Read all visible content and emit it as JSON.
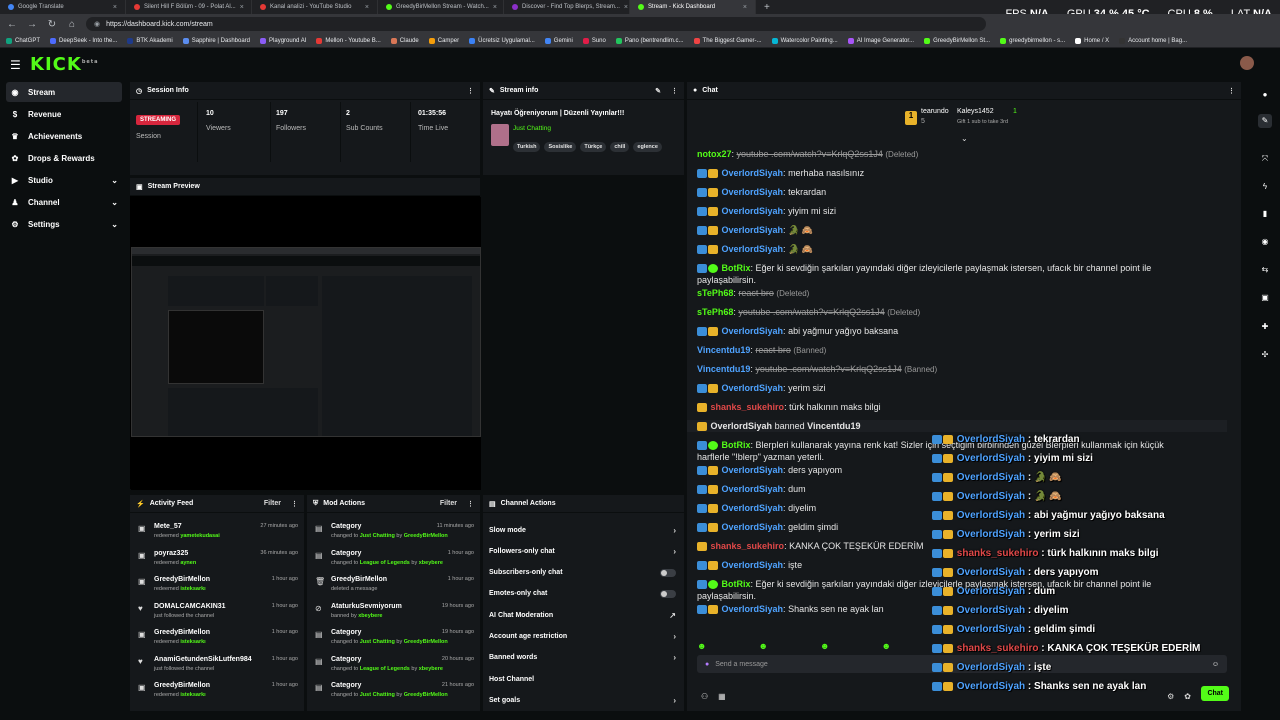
{
  "browser": {
    "tabs": [
      {
        "title": "Google Translate",
        "color": "#4285f4",
        "active": false
      },
      {
        "title": "Silent Hill F Bölüm - 09 - Polat Al...",
        "color": "#e53935",
        "active": false
      },
      {
        "title": "Kanal analizi - YouTube Studio",
        "color": "#e53935",
        "active": false
      },
      {
        "title": "GreedyBirMellon Stream - Watch...",
        "color": "#53fc18",
        "active": false
      },
      {
        "title": "Discover - Find Top Blerps, Stream...",
        "color": "#8b2fc9",
        "active": false
      },
      {
        "title": "Stream - Kick Dashboard",
        "color": "#53fc18",
        "active": true
      }
    ],
    "new_tab": "+",
    "url": "https://dashboard.kick.com/stream",
    "bookmarks": [
      "ChatGPT",
      "DeepSeek - Into the...",
      "BTK Akademi",
      "Sapphire | Dashboard",
      "Playground AI",
      "Mellon - Youtube B...",
      "Claude",
      "Camper",
      "Ücretsiz Uygulamal...",
      "Gemini",
      "Suno",
      "Pano (bentrendlim.c...",
      "The Biggest Gamer-...",
      "Watercolor Painting...",
      "AI Image Generator...",
      "GreedyBirMellon St...",
      "greedybirmellon - s...",
      "Home / X",
      "Account home | Bag..."
    ]
  },
  "sysstats": {
    "fps_label": "FPS",
    "fps_value": "N/A",
    "gpu_label": "GPU",
    "gpu_value": "34 % 45 °C",
    "cpu_label": "CPU",
    "cpu_value": "8 %",
    "lat_label": "LAT",
    "lat_value": "N/A"
  },
  "app": {
    "logo": "KICK",
    "logo_sup": "beta"
  },
  "sidebar": {
    "items": [
      {
        "label": "Stream",
        "icon": "broadcast-icon",
        "active": true,
        "expandable": false
      },
      {
        "label": "Revenue",
        "icon": "dollar-icon",
        "active": false,
        "expandable": false
      },
      {
        "label": "Achievements",
        "icon": "trophy-icon",
        "active": false,
        "expandable": false
      },
      {
        "label": "Drops & Rewards",
        "icon": "gift-icon",
        "active": false,
        "expandable": false
      },
      {
        "label": "Studio",
        "icon": "video-icon",
        "active": false,
        "expandable": true
      },
      {
        "label": "Channel",
        "icon": "user-icon",
        "active": false,
        "expandable": true
      },
      {
        "label": "Settings",
        "icon": "gear-icon",
        "active": false,
        "expandable": true
      }
    ]
  },
  "session": {
    "title": "Session Info",
    "status_badge": "STREAMING",
    "status_label": "Session",
    "stats": [
      {
        "value": "10",
        "label": "Viewers"
      },
      {
        "value": "197",
        "label": "Followers"
      },
      {
        "value": "2",
        "label": "Sub Counts"
      },
      {
        "value": "01:35:56",
        "label": "Time Live"
      }
    ]
  },
  "stream_info": {
    "title": "Stream info",
    "stream_title": "Hayatı Öğreniyorum | Düzenli Yayınlar!!!",
    "category": "Just Chatting",
    "tags": [
      "Turkish",
      "Sosislike",
      "Türkçe",
      "chill",
      "eglence"
    ]
  },
  "preview": {
    "title": "Stream Preview"
  },
  "activity": {
    "title": "Activity Feed",
    "filter": "Filter",
    "items": [
      {
        "name": "Mete_57",
        "action": "redeemed",
        "detail": "yametekudasai",
        "time": "27 minutes ago",
        "icon": "reward-icon"
      },
      {
        "name": "poyraz325",
        "action": "redeemed",
        "detail": "aynen",
        "time": "36 minutes ago",
        "icon": "reward-icon"
      },
      {
        "name": "GreedyBirMellon",
        "action": "redeemed",
        "detail": "isteksarkı",
        "time": "1 hour ago",
        "icon": "reward-icon"
      },
      {
        "name": "DOMALCAMCAKIN31",
        "action": "just followed the channel",
        "detail": "",
        "time": "1 hour ago",
        "icon": "heart-icon"
      },
      {
        "name": "GreedyBirMellon",
        "action": "redeemed",
        "detail": "isteksarkı",
        "time": "1 hour ago",
        "icon": "reward-icon"
      },
      {
        "name": "AnamiGetundenSikLutfen984",
        "action": "just followed the channel",
        "detail": "",
        "time": "1 hour ago",
        "icon": "heart-icon"
      },
      {
        "name": "GreedyBirMellon",
        "action": "redeemed",
        "detail": "isteksarkı",
        "time": "1 hour ago",
        "icon": "reward-icon"
      }
    ]
  },
  "mod_actions": {
    "title": "Mod Actions",
    "filter": "Filter",
    "items": [
      {
        "name": "Category",
        "line": "changed to",
        "target": "Just Chatting",
        "by": "by",
        "actor": "GreedyBirMellon",
        "time": "11 minutes ago",
        "icon": "category-icon"
      },
      {
        "name": "Category",
        "line": "changed to",
        "target": "League of Legends",
        "by": "by",
        "actor": "xbeybere",
        "time": "1 hour ago",
        "icon": "category-icon"
      },
      {
        "name": "GreedyBirMellon",
        "line": "deleted a message",
        "target": "",
        "by": "",
        "actor": "",
        "time": "1 hour ago",
        "icon": "trash-icon"
      },
      {
        "name": "AtaturkuSevmiyorum",
        "line": "banned by",
        "target": "",
        "by": "",
        "actor": "xbeybere",
        "time": "19 hours ago",
        "icon": "ban-icon"
      },
      {
        "name": "Category",
        "line": "changed to",
        "target": "Just Chatting",
        "by": "by",
        "actor": "GreedyBirMellon",
        "time": "19 hours ago",
        "icon": "category-icon"
      },
      {
        "name": "Category",
        "line": "changed to",
        "target": "League of Legends",
        "by": "by",
        "actor": "xbeybere",
        "time": "20 hours ago",
        "icon": "category-icon"
      },
      {
        "name": "Category",
        "line": "changed to",
        "target": "Just Chatting",
        "by": "by",
        "actor": "GreedyBirMellon",
        "time": "21 hours ago",
        "icon": "category-icon"
      }
    ]
  },
  "channel_actions": {
    "title": "Channel Actions",
    "items": [
      {
        "label": "Slow mode",
        "control": "chevron"
      },
      {
        "label": "Followers-only chat",
        "control": "chevron"
      },
      {
        "label": "Subscribers-only chat",
        "control": "toggle"
      },
      {
        "label": "Emotes-only chat",
        "control": "toggle"
      },
      {
        "label": "AI Chat Moderation",
        "control": "external"
      },
      {
        "label": "Account age restriction",
        "control": "chevron"
      },
      {
        "label": "Banned words",
        "control": "chevron"
      },
      {
        "label": "Host Channel",
        "control": "none"
      },
      {
        "label": "Set goals",
        "control": "chevron"
      }
    ]
  },
  "chat": {
    "title": "Chat",
    "leaderboard": {
      "first_name": "tearundo",
      "first_count": "5",
      "second_name": "Kaleys1452",
      "second_count": "1",
      "gift_note": "Gift 1 sub to take 3rd"
    },
    "messages": [
      {
        "user": "notox27",
        "color": "#53fc18",
        "text": "youtube .com/watch?v=KrlqQ2ss1J4",
        "note": "(Deleted)",
        "deleted": true,
        "badges": []
      },
      {
        "user": "OverlordSiyah",
        "color": "#4fa3ff",
        "text": "merhaba nasılsınız",
        "note": "",
        "deleted": false,
        "badges": [
          "mod",
          "crown"
        ]
      },
      {
        "user": "OverlordSiyah",
        "color": "#4fa3ff",
        "text": "tekrardan",
        "note": "",
        "deleted": false,
        "badges": [
          "mod",
          "crown"
        ]
      },
      {
        "user": "OverlordSiyah",
        "color": "#4fa3ff",
        "text": "yiyim mi sizi",
        "note": "",
        "deleted": false,
        "badges": [
          "mod",
          "crown"
        ]
      },
      {
        "user": "OverlordSiyah",
        "color": "#4fa3ff",
        "text": "🐊 🙈",
        "note": "",
        "deleted": false,
        "badges": [
          "mod",
          "crown"
        ]
      },
      {
        "user": "OverlordSiyah",
        "color": "#4fa3ff",
        "text": "🐊 🙈",
        "note": "",
        "deleted": false,
        "badges": [
          "mod",
          "crown"
        ]
      },
      {
        "user": "BotRix",
        "color": "#53fc18",
        "text": "Eğer ki sevdiğin şarkıları yayındaki diğer izleyicilerle paylaşmak istersen, ufacık bir channel point ile paylaşabilirsin.",
        "note": "",
        "deleted": false,
        "badges": [
          "mod",
          "verified"
        ]
      },
      {
        "user": "sTePh68",
        "color": "#53fc18",
        "text": "react bro",
        "note": "(Deleted)",
        "deleted": true,
        "badges": []
      },
      {
        "user": "sTePh68",
        "color": "#53fc18",
        "text": "youtube .com/watch?v=KrlqQ2ss1J4",
        "note": "(Deleted)",
        "deleted": true,
        "badges": []
      },
      {
        "user": "OverlordSiyah",
        "color": "#4fa3ff",
        "text": "abi yağmur yağıyo baksana",
        "note": "",
        "deleted": false,
        "badges": [
          "mod",
          "crown"
        ]
      },
      {
        "user": "Vincentdu19",
        "color": "#4fa3ff",
        "text": "react bro",
        "note": "(Banned)",
        "deleted": true,
        "badges": []
      },
      {
        "user": "Vincentdu19",
        "color": "#4fa3ff",
        "text": "youtube .com/watch?v=KrlqQ2ss1J4",
        "note": "(Banned)",
        "deleted": true,
        "badges": []
      },
      {
        "user": "OverlordSiyah",
        "color": "#4fa3ff",
        "text": "yerim sizi",
        "note": "",
        "deleted": false,
        "badges": [
          "mod",
          "crown"
        ]
      },
      {
        "user": "shanks_sukehiro",
        "color": "#e04848",
        "text": "türk halkının maks bilgi",
        "note": "",
        "deleted": false,
        "badges": [
          "crown"
        ]
      },
      {
        "user": "OverlordSiyah",
        "color": "#e6e6e6",
        "text": "banned",
        "note": "Vincentdu19",
        "deleted": false,
        "badges": [
          "crown"
        ],
        "system": true
      },
      {
        "user": "BotRix",
        "color": "#53fc18",
        "text": "Blerpleri kullanarak yayına renk kat! Sizler için seçtiğim birbirinden güzel Blerpleri kullanmak için küçük harflerle \"!blerp\" yazman yeterli.",
        "note": "",
        "deleted": false,
        "badges": [
          "mod",
          "verified"
        ]
      },
      {
        "user": "OverlordSiyah",
        "color": "#4fa3ff",
        "text": "ders yapıyom",
        "note": "",
        "deleted": false,
        "badges": [
          "mod",
          "crown"
        ]
      },
      {
        "user": "OverlordSiyah",
        "color": "#4fa3ff",
        "text": "dum",
        "note": "",
        "deleted": false,
        "badges": [
          "mod",
          "crown"
        ]
      },
      {
        "user": "OverlordSiyah",
        "color": "#4fa3ff",
        "text": "diyelim",
        "note": "",
        "deleted": false,
        "badges": [
          "mod",
          "crown"
        ]
      },
      {
        "user": "OverlordSiyah",
        "color": "#4fa3ff",
        "text": "geldim şimdi",
        "note": "",
        "deleted": false,
        "badges": [
          "mod",
          "crown"
        ]
      },
      {
        "user": "shanks_sukehiro",
        "color": "#e04848",
        "text": "KANKA ÇOK TEŞEKÜR EDERİM",
        "note": "",
        "deleted": false,
        "badges": [
          "crown"
        ]
      },
      {
        "user": "OverlordSiyah",
        "color": "#4fa3ff",
        "text": "işte",
        "note": "",
        "deleted": false,
        "badges": [
          "mod",
          "crown"
        ]
      },
      {
        "user": "BotRix",
        "color": "#53fc18",
        "text": "Eğer ki sevdiğin şarkıları yayındaki diğer izleyicilerle paylaşmak istersen, ufacık bir channel point ile paylaşabilirsin.",
        "note": "",
        "deleted": false,
        "badges": [
          "mod",
          "verified"
        ]
      },
      {
        "user": "OverlordSiyah",
        "color": "#4fa3ff",
        "text": "Shanks sen ne ayak lan",
        "note": "",
        "deleted": false,
        "badges": [
          "mod",
          "crown"
        ]
      }
    ],
    "input_placeholder": "Send a message",
    "send_label": "Chat"
  },
  "overlay": {
    "lines": [
      {
        "user": "OverlordSiyah",
        "text": ": tekrardan",
        "red": false
      },
      {
        "user": "OverlordSiyah",
        "text": ": yiyim mi sizi",
        "red": false
      },
      {
        "user": "OverlordSiyah",
        "text": ": 🐊 🙈",
        "red": false
      },
      {
        "user": "OverlordSiyah",
        "text": ": 🐊 🙈",
        "red": false
      },
      {
        "user": "OverlordSiyah",
        "text": ": abi yağmur yağıyo baksana",
        "red": false
      },
      {
        "user": "OverlordSiyah",
        "text": ": yerim sizi",
        "red": false
      },
      {
        "user": "shanks_sukehiro",
        "text": ": türk halkının maks bilgi",
        "red": true
      },
      {
        "user": "OverlordSiyah",
        "text": ": ders yapıyom",
        "red": false
      },
      {
        "user": "OverlordSiyah",
        "text": ": dum",
        "red": false
      },
      {
        "user": "OverlordSiyah",
        "text": ": diyelim",
        "red": false
      },
      {
        "user": "OverlordSiyah",
        "text": ": geldim şimdi",
        "red": false
      },
      {
        "user": "shanks_sukehiro",
        "text": ": KANKA ÇOK TEŞEKÜR EDERİM",
        "red": true
      },
      {
        "user": "OverlordSiyah",
        "text": ": işte",
        "red": false
      },
      {
        "user": "OverlordSiyah",
        "text": ": Shanks sen ne ayak lan",
        "red": false
      }
    ]
  },
  "rail": {
    "icons": [
      "info-icon",
      "edit-icon",
      "expand-icon",
      "flash-icon",
      "trash-icon",
      "chat-bubble-icon",
      "swap-icon",
      "save-icon",
      "wrench-icon",
      "puzzle-icon"
    ]
  },
  "colors": {
    "accent": "#53fc18",
    "live": "#d7263d",
    "panel": "#15181b",
    "bg": "#0b0e0f"
  }
}
